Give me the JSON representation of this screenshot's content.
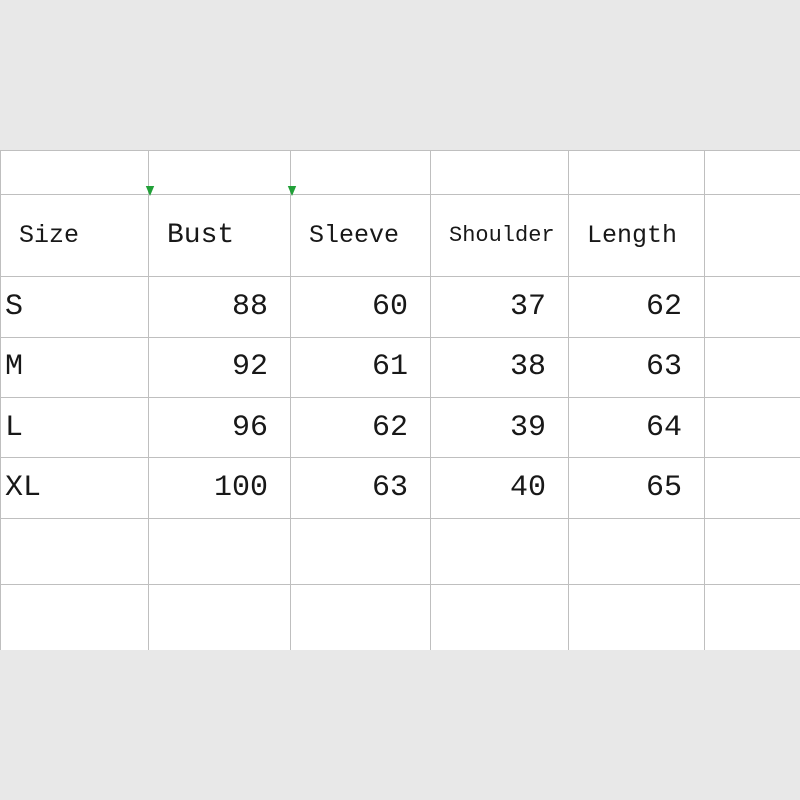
{
  "chart_data": {
    "type": "table",
    "title": "",
    "columns": [
      "Size",
      "Bust",
      "Sleeve",
      "Shoulder",
      "Length"
    ],
    "rows": [
      {
        "size": "S",
        "bust": 88,
        "sleeve": 60,
        "shoulder": 37,
        "length": 62
      },
      {
        "size": "M",
        "bust": 92,
        "sleeve": 61,
        "shoulder": 38,
        "length": 63
      },
      {
        "size": "L",
        "bust": 96,
        "sleeve": 62,
        "shoulder": 39,
        "length": 64
      },
      {
        "size": "XL",
        "bust": 100,
        "sleeve": 63,
        "shoulder": 40,
        "length": 65
      }
    ]
  },
  "headers": {
    "size": "Size",
    "bust": "Bust",
    "sleeve": "Sleeve",
    "shoulder": "Shoulder",
    "length": "Length"
  },
  "rows": [
    {
      "size": "S",
      "bust": "88",
      "sleeve": "60",
      "shoulder": "37",
      "length": "62"
    },
    {
      "size": "M",
      "bust": "92",
      "sleeve": "61",
      "shoulder": "38",
      "length": "63"
    },
    {
      "size": "L",
      "bust": "96",
      "sleeve": "62",
      "shoulder": "39",
      "length": "64"
    },
    {
      "size": "XL",
      "bust": "100",
      "sleeve": "63",
      "shoulder": "40",
      "length": "65"
    }
  ]
}
